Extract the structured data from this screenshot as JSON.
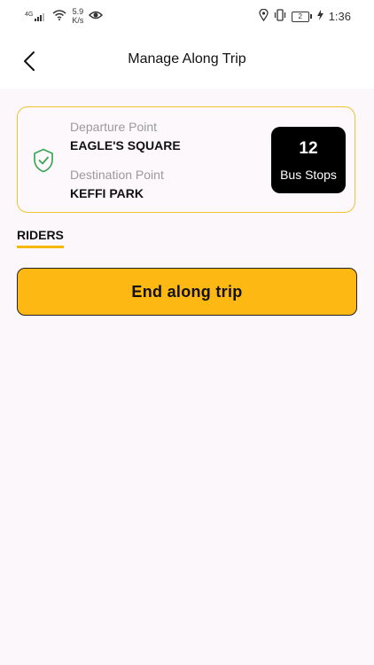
{
  "status_bar": {
    "network": "4G",
    "speed_value": "5.9",
    "speed_unit": "K/s",
    "battery": "2",
    "time": "1:36"
  },
  "app_bar": {
    "title": "Manage Along Trip"
  },
  "trip_card": {
    "departure_label": "Departure Point",
    "departure_value": "EAGLE'S SQUARE",
    "destination_label": "Destination Point",
    "destination_value": "KEFFI PARK",
    "stops_count": "12",
    "stops_label": "Bus Stops"
  },
  "tabs": {
    "riders": "RIDERS"
  },
  "actions": {
    "end_trip": "End along trip"
  },
  "colors": {
    "accent": "#fdb813",
    "card_border": "#f2c230",
    "check_green": "#3aa655"
  },
  "icons": [
    "signal-icon",
    "wifi-icon",
    "eye-icon",
    "location-icon",
    "vibrate-icon",
    "battery-icon",
    "charging-icon",
    "back-arrow-icon",
    "shield-check-icon"
  ]
}
